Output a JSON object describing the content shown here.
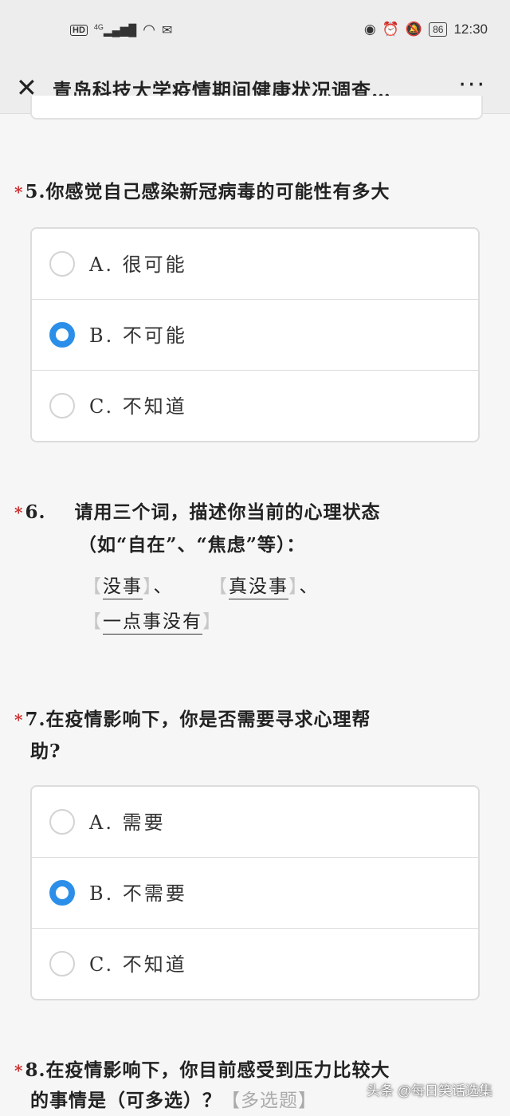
{
  "status_bar": {
    "left_icons": [
      "hd-icon",
      "signal-4g-icon",
      "wifi-icon",
      "app-icon"
    ],
    "hd": "HD",
    "net": "4G",
    "battery": "86",
    "time": "12:30"
  },
  "header": {
    "title": "青岛科技大学疫情期间健康状况调查…",
    "more": "···"
  },
  "q5": {
    "number": "5.",
    "question": "你感觉自己感染新冠病毒的可能性有多大",
    "options": [
      {
        "label": "A. 很可能",
        "selected": false
      },
      {
        "label": "B. 不可能",
        "selected": true
      },
      {
        "label": "C. 不知道",
        "selected": false
      }
    ]
  },
  "q6": {
    "number": "6.",
    "question": "请用三个词，描述你当前的心理状态",
    "sub": "（如“自在”、“焦虑”等）：",
    "answers": [
      "没事",
      "真没事",
      "一点事没有"
    ],
    "sep": "、"
  },
  "q7": {
    "number": "7.",
    "question_line1": "在疫情影响下，你是否需要寻求心理帮",
    "question_line2": "助?",
    "options": [
      {
        "label": "A. 需要",
        "selected": false
      },
      {
        "label": "B. 不需要",
        "selected": true
      },
      {
        "label": "C. 不知道",
        "selected": false
      }
    ]
  },
  "q8": {
    "number": "8.",
    "question_line1": "在疫情影响下，你目前感受到压力比较大",
    "question_line2": "的事情是（可多选）？",
    "tag": "【多选题】"
  },
  "watermark": "头条 @每日笑话选集"
}
